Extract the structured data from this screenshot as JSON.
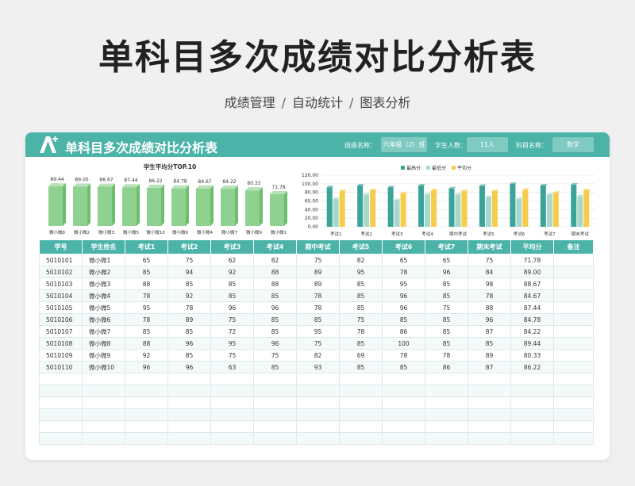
{
  "page": {
    "title": "单科目多次成绩对比分析表",
    "tags": [
      "成绩管理",
      "自动统计",
      "图表分析"
    ],
    "tag_separator": "/"
  },
  "sheet": {
    "title": "单科目多次成绩对比分析表",
    "class_label": "班级名称：",
    "class_value": "六年级（2）班",
    "count_label": "学生人数：",
    "count_value": "11人",
    "subject_label": "科目名称：",
    "subject_value": "数学"
  },
  "colors": {
    "accent": "#4bb3a8",
    "bar_green": "#8fd18f",
    "max_color": "#3aa39a",
    "min_color": "#a8d8cc",
    "avg_color": "#f5cd4a"
  },
  "chart_data": [
    {
      "type": "bar",
      "title": "学生平均分TOP.10",
      "categories": [
        "微小微8",
        "微小微2",
        "微小微3",
        "微小微5",
        "微小微10",
        "微小微6",
        "微小微4",
        "微小微7",
        "微小微9",
        "微小微1"
      ],
      "values": [
        89.44,
        89.0,
        88.67,
        87.44,
        86.22,
        84.78,
        84.67,
        84.22,
        80.33,
        71.78
      ],
      "value_labels": [
        "89.44",
        "89.00",
        "88.67",
        "87.44",
        "86.22",
        "84.78",
        "84.67",
        "84.22",
        "80.33",
        "71.78"
      ],
      "ylim": [
        0,
        100
      ]
    },
    {
      "type": "bar",
      "categories": [
        "考试1",
        "考试2",
        "考试3",
        "考试4",
        "期中考试",
        "考试5",
        "考试6",
        "考试7",
        "期末考试"
      ],
      "series": [
        {
          "name": "最高分",
          "values": [
            92,
            96,
            92,
            96,
            89,
            95,
            100,
            96,
            98
          ]
        },
        {
          "name": "最低分",
          "values": [
            65,
            75,
            62,
            75,
            75,
            69,
            65,
            75,
            71
          ]
        },
        {
          "name": "平均分",
          "values": [
            83,
            85,
            78,
            85,
            83,
            83,
            86,
            79,
            85
          ]
        }
      ],
      "ylim": [
        0,
        120
      ],
      "yticks": [
        "120.00",
        "100.00",
        "80.00",
        "60.00",
        "40.00",
        "20.00",
        "0.00"
      ],
      "legend": "top"
    }
  ],
  "table": {
    "headers": [
      "学号",
      "学生姓名",
      "考试1",
      "考试2",
      "考试3",
      "考试4",
      "期中考试",
      "考试5",
      "考试6",
      "考试7",
      "期末考试",
      "平均分",
      "备注"
    ],
    "rows": [
      [
        "5010101",
        "微小微1",
        "65",
        "75",
        "62",
        "82",
        "75",
        "82",
        "65",
        "65",
        "75",
        "71.78",
        ""
      ],
      [
        "5010102",
        "微小微2",
        "85",
        "94",
        "92",
        "88",
        "89",
        "95",
        "78",
        "96",
        "84",
        "89.00",
        ""
      ],
      [
        "5010103",
        "微小微3",
        "88",
        "85",
        "85",
        "88",
        "89",
        "85",
        "95",
        "85",
        "98",
        "88.67",
        ""
      ],
      [
        "5010104",
        "微小微4",
        "78",
        "92",
        "85",
        "85",
        "78",
        "85",
        "96",
        "85",
        "78",
        "84.67",
        ""
      ],
      [
        "5010105",
        "微小微5",
        "95",
        "78",
        "96",
        "96",
        "78",
        "85",
        "96",
        "75",
        "88",
        "87.44",
        ""
      ],
      [
        "5010106",
        "微小微6",
        "78",
        "89",
        "75",
        "85",
        "85",
        "75",
        "85",
        "85",
        "96",
        "84.78",
        ""
      ],
      [
        "5010107",
        "微小微7",
        "85",
        "85",
        "72",
        "85",
        "95",
        "78",
        "86",
        "85",
        "87",
        "84.22",
        ""
      ],
      [
        "5010108",
        "微小微8",
        "88",
        "96",
        "95",
        "96",
        "75",
        "85",
        "100",
        "85",
        "85",
        "89.44",
        ""
      ],
      [
        "5010109",
        "微小微9",
        "92",
        "85",
        "75",
        "75",
        "82",
        "69",
        "78",
        "78",
        "89",
        "80.33",
        ""
      ],
      [
        "5010110",
        "微小微10",
        "96",
        "96",
        "63",
        "85",
        "93",
        "85",
        "85",
        "86",
        "87",
        "86.22",
        ""
      ]
    ],
    "empty_rows": 6
  }
}
